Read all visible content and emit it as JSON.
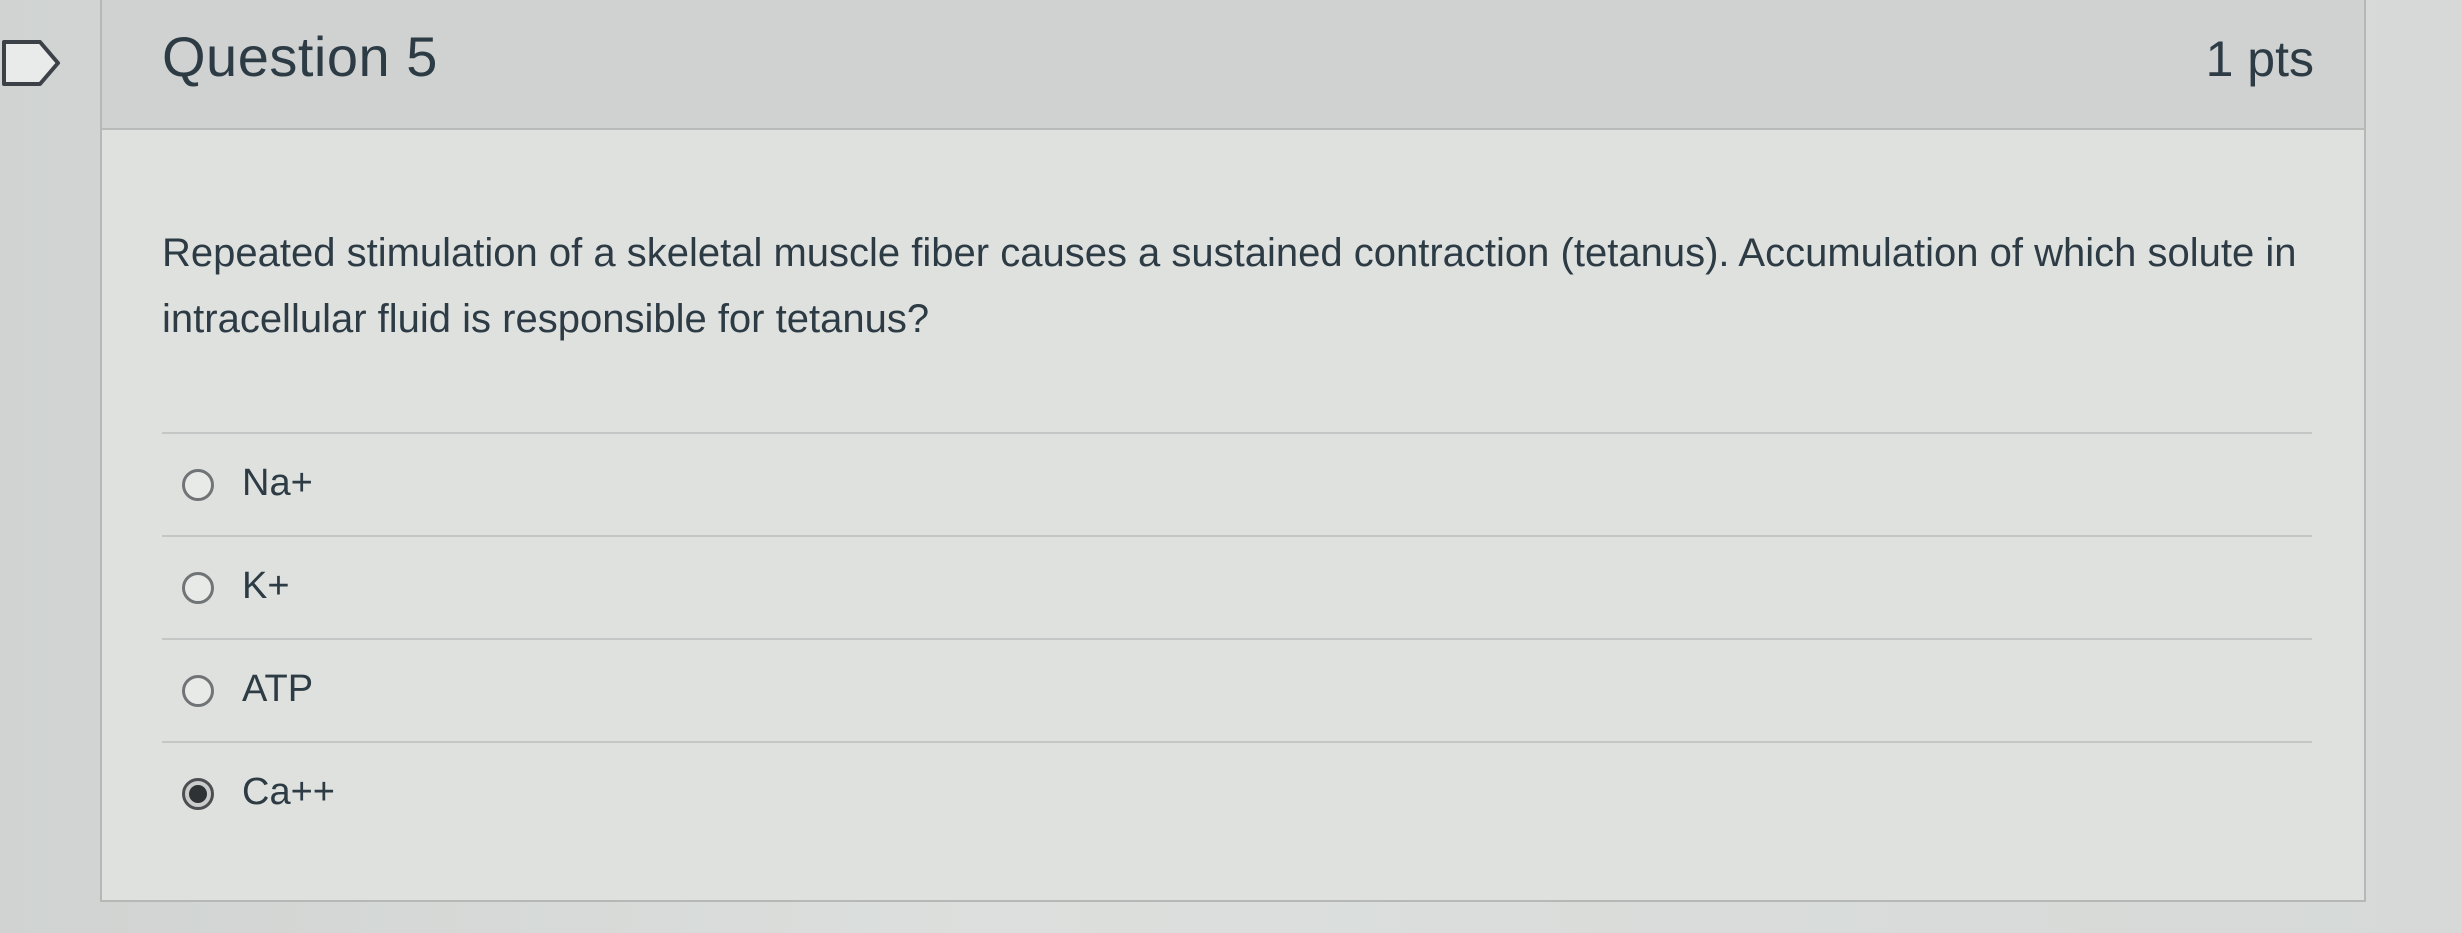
{
  "question": {
    "title": "Question 5",
    "points": "1 pts",
    "text": "Repeated stimulation of a skeletal muscle fiber causes a sustained contraction (tetanus). Accumulation of which solute in intracellular fluid is responsible for tetanus?"
  },
  "answers": [
    {
      "label": "Na+",
      "selected": false
    },
    {
      "label": "K+",
      "selected": false
    },
    {
      "label": "ATP",
      "selected": false
    },
    {
      "label": "Ca++",
      "selected": true
    }
  ],
  "icons": {
    "flag": "flag-icon",
    "radio": "radio-button"
  }
}
